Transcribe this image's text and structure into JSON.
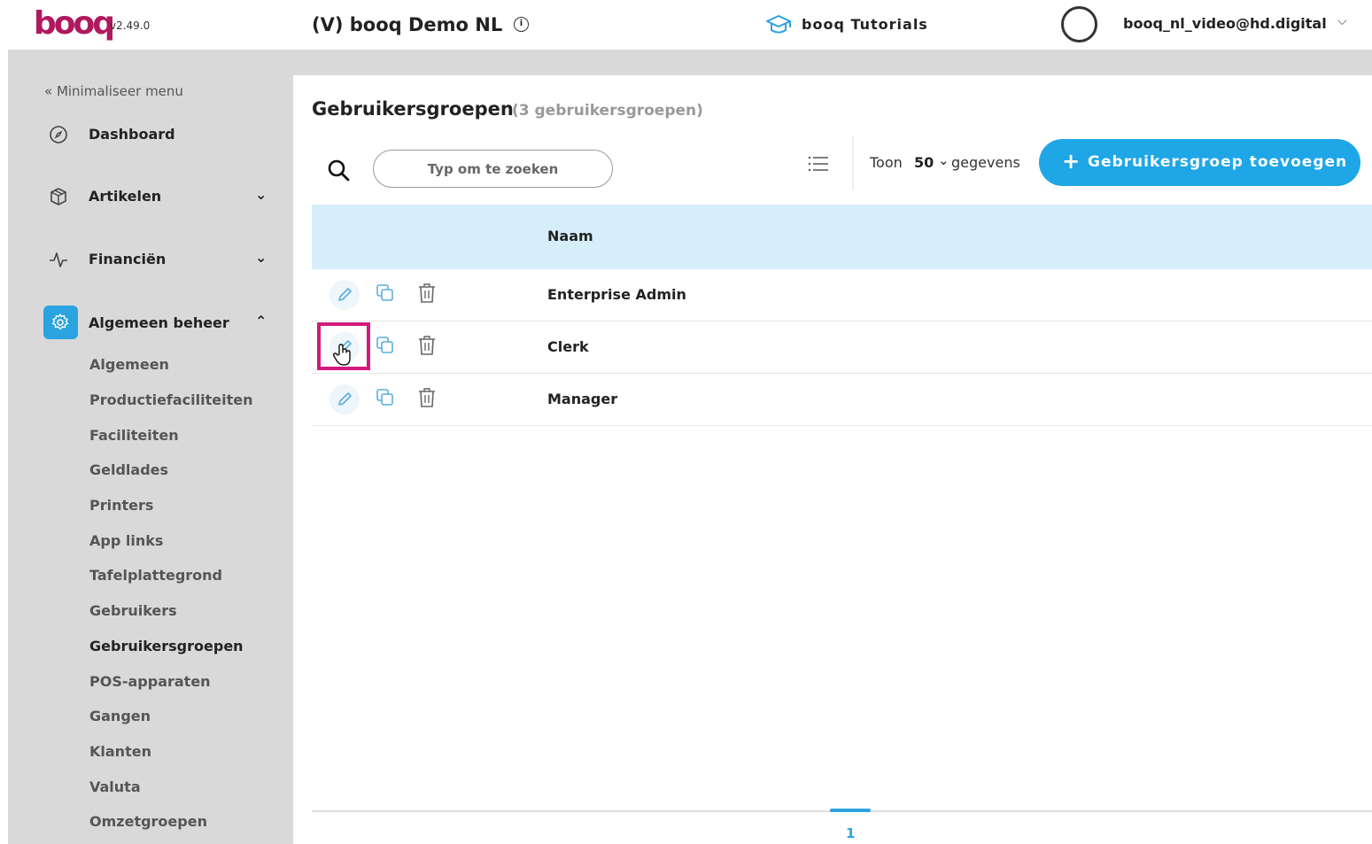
{
  "header": {
    "logo": "booq",
    "version": "v2.49.0",
    "venue": "(V) booq Demo NL",
    "info_icon": "info-circle-icon",
    "tutorials": "booq Tutorials",
    "tutorials_icon": "graduation-cap-icon",
    "user_email": "booq_nl_video@hd.digital",
    "accent": "#b0195f"
  },
  "sidebar": {
    "minimize_label": "« Minimaliseer menu",
    "main_items": [
      {
        "label": "Dashboard",
        "icon": "dashboard-icon"
      },
      {
        "label": "Artikelen",
        "icon": "box-icon"
      },
      {
        "label": "Financiën",
        "icon": "pulse-icon"
      },
      {
        "label": "Algemeen beheer",
        "icon": "gear-icon"
      }
    ],
    "sub_items": [
      "Algemeen",
      "Productiefaciliteiten",
      "Faciliteiten",
      "Geldlades",
      "Printers",
      "App links",
      "Tafelplattegrond",
      "Gebruikers",
      "Gebruikersgroepen",
      "POS-apparaten",
      "Gangen",
      "Klanten",
      "Valuta",
      "Omzetgroepen"
    ],
    "current": "Gebruikersgroepen",
    "active_color": "#2ba3e0"
  },
  "main": {
    "title": "Gebruikersgroepen",
    "count": "(3 gebruikersgroepen)",
    "search_placeholder": "Typ om te zoeken",
    "toon_label": "Toon",
    "toon_value": "50",
    "gegevens_label": "gegevens",
    "add_button_plus": "+",
    "add_button_label": "Gebruikersgroep toevoegen",
    "button_color": "#1ea6e6",
    "table": {
      "header_name": "Naam",
      "rows": [
        {
          "name": "Enterprise Admin"
        },
        {
          "name": "Clerk"
        },
        {
          "name": "Manager"
        }
      ]
    },
    "pagination": {
      "current": "1"
    },
    "highlight_color": "#d21a7d"
  }
}
